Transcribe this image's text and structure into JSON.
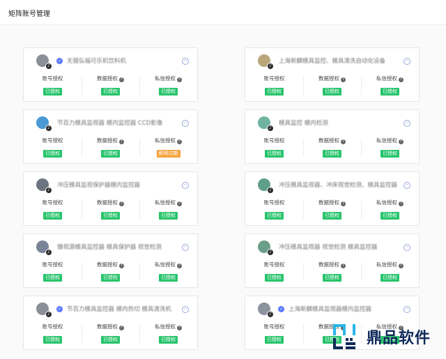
{
  "page": {
    "title": "矩阵账号管理"
  },
  "perm_labels": {
    "account": "账号授权",
    "data": "数据授权",
    "message": "私信授权"
  },
  "cards": [
    {
      "name": "无锡弘福可乐机饮料机",
      "avatar_color": "#8a8f98",
      "verified": true,
      "status": [
        "已授权",
        "已授权",
        "已授权"
      ]
    },
    {
      "name": "上海新麟模具监控、模具清洗自动化设备",
      "avatar_color": "#b9a77a",
      "verified": false,
      "status": [
        "已授权",
        "已授权",
        "已授权"
      ]
    },
    {
      "name": "节百力模具监视器 模内监控器 CCD影像",
      "avatar_color": "#4a9ad4",
      "verified": false,
      "status": [
        "已授权",
        "已授权",
        "即将过期"
      ]
    },
    {
      "name": "模具监控 模内检测",
      "avatar_color": "#6fb3a0",
      "verified": false,
      "status": [
        "已授权",
        "已授权",
        "已授权"
      ]
    },
    {
      "name": "冲压模具监视保护器模内监控器",
      "avatar_color": "#6d7480",
      "verified": false,
      "status": [
        "已授权",
        "已授权",
        "已授权"
      ]
    },
    {
      "name": "冲压模具监视器、冲床视觉检测、模具监控器",
      "avatar_color": "#5e9f8c",
      "verified": false,
      "status": [
        "已授权",
        "已授权",
        "已授权"
      ]
    },
    {
      "name": "慷视源模具监控器 模具保护器 视觉检测",
      "avatar_color": "#7a8499",
      "verified": false,
      "status": [
        "已授权",
        "已授权",
        "已授权"
      ]
    },
    {
      "name": "冲压模具监视器 视觉检测 模具监控器",
      "avatar_color": "#6a9f8a",
      "verified": false,
      "status": [
        "已授权",
        "已授权",
        "已授权"
      ]
    },
    {
      "name": "节百力模具监控器 模内热切 模具清洗机",
      "avatar_color": "#8b8f97",
      "verified": true,
      "status": [
        "已授权",
        "已授权",
        "已授权"
      ]
    },
    {
      "name": "上海新麟模具监视器模内监控器",
      "avatar_color": "#8d939c",
      "verified": true,
      "status": [
        "已授权",
        "已授权",
        "已授权"
      ]
    }
  ],
  "colors": {
    "authorized": "#27c46b",
    "expiring": "#f5a23c",
    "verified": "#5b7bff"
  },
  "icons": {
    "avatar_badge": "tiktok-icon",
    "more": "more-circle-icon",
    "help": "question-mark-icon"
  },
  "watermark": {
    "text": "鼎品软件"
  }
}
